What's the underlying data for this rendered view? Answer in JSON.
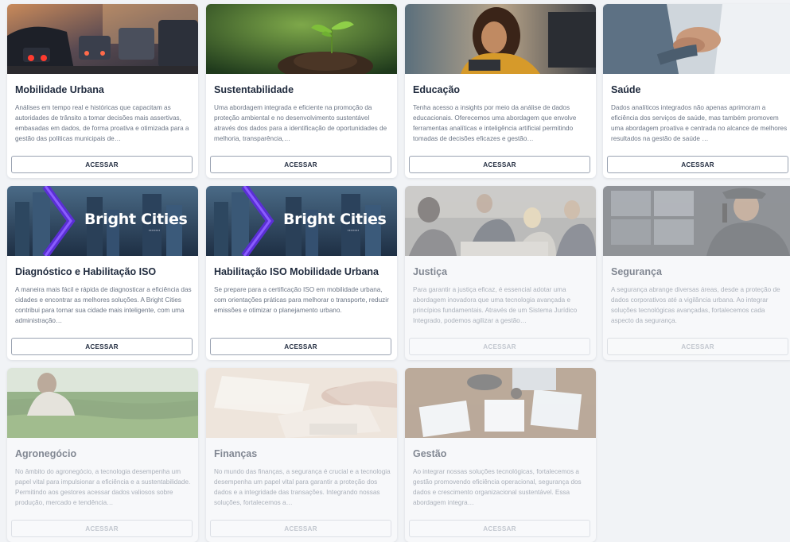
{
  "cards": [
    {
      "title": "Mobilidade Urbana",
      "description": "Análises em tempo real e históricas que capacitam as autoridades de trânsito a tomar decisões mais assertivas, embasadas em dados, de forma proativa e otimizada para a gestão das políticas municipais de…",
      "button": "ACESSAR",
      "active": true,
      "image": "traffic-photo"
    },
    {
      "title": "Sustentabilidade",
      "description": "Uma abordagem integrada e eficiente na promoção da proteção ambiental e no desenvolvimento sustentável através dos dados para a identificação de oportunidades de melhoria, transparência,…",
      "button": "ACESSAR",
      "active": true,
      "image": "seedling-photo"
    },
    {
      "title": "Educação",
      "description": "Tenha acesso a insights por meio da análise de dados educacionais. Oferecemos uma abordagem que envolve ferramentas analíticas e inteligência artificial permitindo tomadas de decisões eficazes e gestão…",
      "button": "ACESSAR",
      "active": true,
      "image": "student-photo"
    },
    {
      "title": "Saúde",
      "description": "Dados analíticos integrados não apenas aprimoram a eficiência dos serviços de saúde, mas também promovem uma abordagem proativa e centrada no alcance de melhores resultados na gestão de saúde …",
      "button": "ACESSAR",
      "active": true,
      "image": "hands-photo"
    },
    {
      "title": "Diagnóstico e Habilitação ISO",
      "description": "A maneira mais fácil e rápida de diagnosticar a eficiência das cidades e encontrar as melhores soluções. A Bright Cities contribui para tornar sua cidade mais inteligente, com uma administração…",
      "button": "ACESSAR",
      "active": true,
      "image": "bright-cities-banner",
      "logo": "Bright Cities"
    },
    {
      "title": "Habilitação ISO Mobilidade Urbana",
      "description": "Se prepare para a certificação ISO em mobilidade urbana, com orientações práticas para melhorar o transporte, reduzir emissões e otimizar o planejamento urbano.",
      "button": "ACESSAR",
      "active": true,
      "image": "bright-cities-banner",
      "logo": "Bright Cities"
    },
    {
      "title": "Justiça",
      "description": "Para garantir a justiça eficaz, é essencial adotar uma abordagem inovadora que uma tecnologia avançada e princípios fundamentais. Através de um Sistema Jurídico Integrado, podemos agilizar a gestão…",
      "button": "ACESSAR",
      "active": false,
      "image": "meeting-photo"
    },
    {
      "title": "Segurança",
      "description": "A segurança abrange diversas áreas, desde a proteção de dados corporativos até a vigilância urbana. Ao integrar soluções tecnológicas avançadas, fortalecemos cada aspecto da segurança.",
      "button": "ACESSAR",
      "active": false,
      "image": "security-photo"
    },
    {
      "title": "Agronegócio",
      "description": "No âmbito do agronegócio, a tecnologia desempenha um papel vital para impulsionar a eficiência e a sustentabilidade. Permitindo aos gestores acessar dados valiosos sobre produção, mercado e tendência…",
      "button": "ACESSAR",
      "active": false,
      "image": "farm-photo"
    },
    {
      "title": "Finanças",
      "description": "No mundo das finanças, a segurança é crucial e a tecnologia desempenha um papel vital para garantir a proteção dos dados e a integridade das transações. Integrando nossas soluções, fortalecemos a…",
      "button": "ACESSAR",
      "active": false,
      "image": "finance-photo"
    },
    {
      "title": "Gestão",
      "description": "Ao integrar nossas soluções tecnológicas, fortalecemos a gestão promovendo eficiência operacional, segurança dos dados e crescimento organizacional sustentável. Essa abordagem integra…",
      "button": "ACESSAR",
      "active": false,
      "image": "management-photo"
    }
  ]
}
